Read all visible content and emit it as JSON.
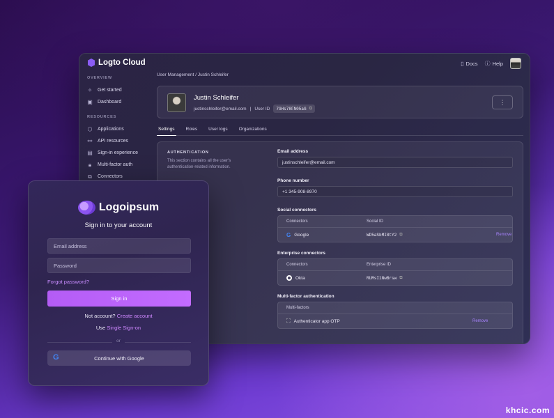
{
  "console": {
    "brand": "Logto Cloud",
    "top": {
      "docs": "Docs",
      "help": "Help",
      "docs_icon": "doc-icon",
      "help_icon": "help-icon"
    },
    "sidebar": {
      "section_overview": "OVERVIEW",
      "overview_items": [
        {
          "label": "Get started",
          "icon": "sparkle-icon"
        },
        {
          "label": "Dashboard",
          "icon": "dashboard-icon"
        }
      ],
      "section_resources": "RESOURCES",
      "resource_items": [
        {
          "label": "Applications",
          "icon": "cube-icon"
        },
        {
          "label": "API resources",
          "icon": "link-icon"
        },
        {
          "label": "Sign-in experience",
          "icon": "layout-icon"
        },
        {
          "label": "Multi-factor auth",
          "icon": "lock-icon"
        },
        {
          "label": "Connectors",
          "icon": "plug-icon"
        }
      ]
    },
    "breadcrumb": "User Management / Justin Schleifer",
    "user": {
      "name": "Justin Schleifer",
      "email": "justinschleifer@email.com",
      "separator": "|",
      "user_id_label": "User ID",
      "user_id": "7GHs78FN05aG",
      "more": "⋮"
    },
    "tabs": [
      "Settings",
      "Roles",
      "User logs",
      "Organizations"
    ],
    "auth": {
      "title": "AUTHENTICATION",
      "description": "This section contains all the user's authentication-related information.",
      "email_label": "Email address",
      "email_value": "justinschleifer@email.com",
      "phone_label": "Phone number",
      "phone_value": "+1 345-908-8970",
      "social_label": "Social connectors",
      "social_head": [
        "Connectors",
        "Social ID"
      ],
      "social_row": {
        "name": "Google",
        "id": "WD5aSbMI8tY2",
        "action": "Remove"
      },
      "enterprise_label": "Enterprise connectors",
      "enterprise_head": [
        "Connectors",
        "Enterprise ID"
      ],
      "enterprise_row": {
        "name": "Okta",
        "id": "RUMsI1NwBrsw"
      },
      "mfa_label": "Multi-factor authentication",
      "mfa_head": "Multi-factors",
      "mfa_row": {
        "name": "Authenticator app OTP",
        "action": "Remove"
      }
    }
  },
  "signin": {
    "logo_text": "Logoipsum",
    "title": "Sign in to your account",
    "email_placeholder": "Email address",
    "password_placeholder": "Password",
    "forgot": "Forgot password?",
    "signin_button": "Sign in",
    "no_account": "Not account?",
    "create_account": "Create account",
    "use": "Use",
    "sso": "Single Sign-on",
    "or": "or",
    "google_button": "Continue with Google"
  },
  "watermark": "khcic.com",
  "colors": {
    "accent": "#c36cff",
    "link": "#cf88ff",
    "remove": "#a883ff"
  }
}
